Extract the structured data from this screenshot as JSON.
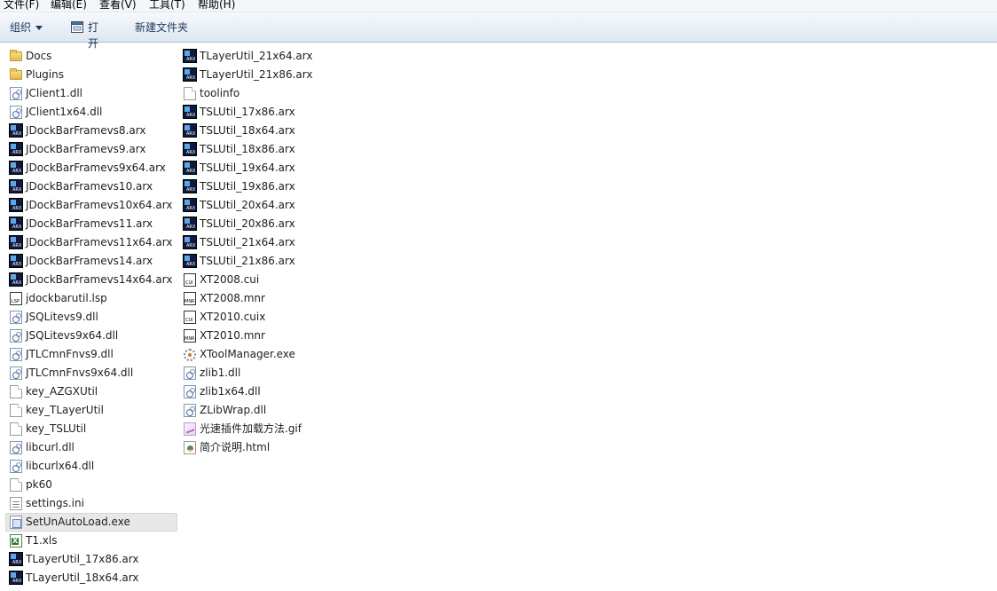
{
  "menu": {
    "items": [
      "文件(F)",
      "编辑(E)",
      "查看(V)",
      "工具(T)",
      "帮助(H)"
    ]
  },
  "toolbar": {
    "organize_label": "组织",
    "open_label": "打开",
    "new_folder_label": "新建文件夹"
  },
  "files": {
    "column1": [
      {
        "name": "Docs",
        "icon": "folder-icon"
      },
      {
        "name": "Plugins",
        "icon": "folder-icon"
      },
      {
        "name": "JClient1.dll",
        "icon": "dll-file-icon"
      },
      {
        "name": "JClient1x64.dll",
        "icon": "dll-file-icon"
      },
      {
        "name": "JDockBarFramevs8.arx",
        "icon": "arx-file-icon"
      },
      {
        "name": "JDockBarFramevs9.arx",
        "icon": "arx-file-icon"
      },
      {
        "name": "JDockBarFramevs9x64.arx",
        "icon": "arx-file-icon"
      },
      {
        "name": "JDockBarFramevs10.arx",
        "icon": "arx-file-icon"
      },
      {
        "name": "JDockBarFramevs10x64.arx",
        "icon": "arx-file-icon"
      },
      {
        "name": "JDockBarFramevs11.arx",
        "icon": "arx-file-icon"
      },
      {
        "name": "JDockBarFramevs11x64.arx",
        "icon": "arx-file-icon"
      },
      {
        "name": "JDockBarFramevs14.arx",
        "icon": "arx-file-icon"
      },
      {
        "name": "JDockBarFramevs14x64.arx",
        "icon": "arx-file-icon"
      },
      {
        "name": "jdockbarutil.lsp",
        "icon": "lsp-file-icon"
      },
      {
        "name": "JSQLitevs9.dll",
        "icon": "dll-file-icon"
      },
      {
        "name": "JSQLitevs9x64.dll",
        "icon": "dll-file-icon"
      },
      {
        "name": "JTLCmnFnvs9.dll",
        "icon": "dll-file-icon"
      },
      {
        "name": "JTLCmnFnvs9x64.dll",
        "icon": "dll-file-icon"
      },
      {
        "name": "key_AZGXUtil",
        "icon": "generic-file-icon"
      },
      {
        "name": "key_TLayerUtil",
        "icon": "generic-file-icon"
      },
      {
        "name": "key_TSLUtil",
        "icon": "generic-file-icon"
      },
      {
        "name": "libcurl.dll",
        "icon": "dll-file-icon"
      },
      {
        "name": "libcurlx64.dll",
        "icon": "dll-file-icon"
      },
      {
        "name": "pk60",
        "icon": "generic-file-icon"
      },
      {
        "name": "settings.ini",
        "icon": "ini-file-icon"
      },
      {
        "name": "SetUnAutoLoad.exe",
        "icon": "exe-file-icon",
        "selected": true
      },
      {
        "name": "T1.xls",
        "icon": "excel-file-icon"
      },
      {
        "name": "TLayerUtil_17x86.arx",
        "icon": "arx-file-icon"
      },
      {
        "name": "TLayerUtil_18x64.arx",
        "icon": "arx-file-icon"
      }
    ],
    "column2": [
      {
        "name": "TLayerUtil_21x64.arx",
        "icon": "arx-file-icon"
      },
      {
        "name": "TLayerUtil_21x86.arx",
        "icon": "arx-file-icon"
      },
      {
        "name": "toolinfo",
        "icon": "generic-file-icon"
      },
      {
        "name": "TSLUtil_17x86.arx",
        "icon": "arx-file-icon"
      },
      {
        "name": "TSLUtil_18x64.arx",
        "icon": "arx-file-icon"
      },
      {
        "name": "TSLUtil_18x86.arx",
        "icon": "arx-file-icon"
      },
      {
        "name": "TSLUtil_19x64.arx",
        "icon": "arx-file-icon"
      },
      {
        "name": "TSLUtil_19x86.arx",
        "icon": "arx-file-icon"
      },
      {
        "name": "TSLUtil_20x64.arx",
        "icon": "arx-file-icon"
      },
      {
        "name": "TSLUtil_20x86.arx",
        "icon": "arx-file-icon"
      },
      {
        "name": "TSLUtil_21x64.arx",
        "icon": "arx-file-icon"
      },
      {
        "name": "TSLUtil_21x86.arx",
        "icon": "arx-file-icon"
      },
      {
        "name": "XT2008.cui",
        "icon": "cui-file-icon"
      },
      {
        "name": "XT2008.mnr",
        "icon": "mnr-file-icon"
      },
      {
        "name": "XT2010.cuix",
        "icon": "cui-file-icon"
      },
      {
        "name": "XT2010.mnr",
        "icon": "mnr-file-icon"
      },
      {
        "name": "XToolManager.exe",
        "icon": "gear-exe-icon"
      },
      {
        "name": "zlib1.dll",
        "icon": "dll-file-icon"
      },
      {
        "name": "zlib1x64.dll",
        "icon": "dll-file-icon"
      },
      {
        "name": "ZLibWrap.dll",
        "icon": "dll-file-icon"
      },
      {
        "name": "光速插件加载方法.gif",
        "icon": "gif-file-icon"
      },
      {
        "name": "简介说明.html",
        "icon": "html-file-icon"
      }
    ]
  }
}
